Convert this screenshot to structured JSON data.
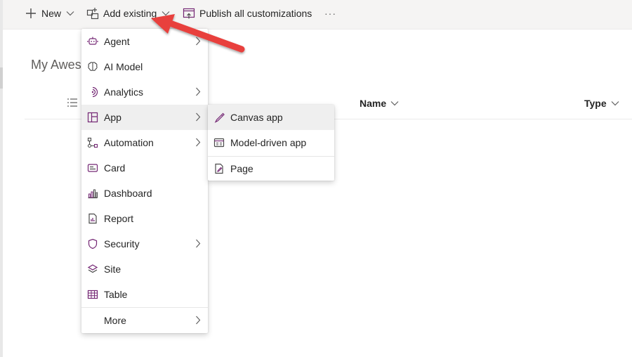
{
  "toolbar": {
    "new_label": "New",
    "add_existing_label": "Add existing",
    "publish_label": "Publish all customizations",
    "more_glyph": "···"
  },
  "page": {
    "title": "My Awes"
  },
  "grid": {
    "columns": [
      {
        "label": "Name"
      },
      {
        "label": "Type"
      }
    ]
  },
  "add_menu": {
    "items": [
      {
        "label": "Agent"
      },
      {
        "label": "AI Model"
      },
      {
        "label": "Analytics"
      },
      {
        "label": "App"
      },
      {
        "label": "Automation"
      },
      {
        "label": "Card"
      },
      {
        "label": "Dashboard"
      },
      {
        "label": "Report"
      },
      {
        "label": "Security"
      },
      {
        "label": "Site"
      },
      {
        "label": "Table"
      },
      {
        "label": "More"
      }
    ]
  },
  "app_submenu": {
    "items": [
      {
        "label": "Canvas app"
      },
      {
        "label": "Model-driven app"
      },
      {
        "label": "Page"
      }
    ]
  },
  "colors": {
    "accent": "#742774",
    "arrow": "#e8403d",
    "toolbar_bg": "#f5f4f3"
  }
}
